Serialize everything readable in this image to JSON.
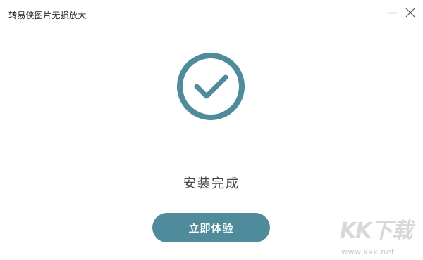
{
  "window": {
    "title": "转易侠图片无损放大",
    "controls": {
      "minimize_icon": "minimize-icon",
      "close_icon": "close-icon"
    }
  },
  "main": {
    "success_icon": "check-circle-icon",
    "status": "安装完成",
    "action_button": "立即体验"
  },
  "watermark": {
    "logo": "KK下载",
    "url": "www.kkx.net"
  },
  "colors": {
    "accent": "#4f8b9a",
    "text": "#444444",
    "background": "#ffffff"
  }
}
